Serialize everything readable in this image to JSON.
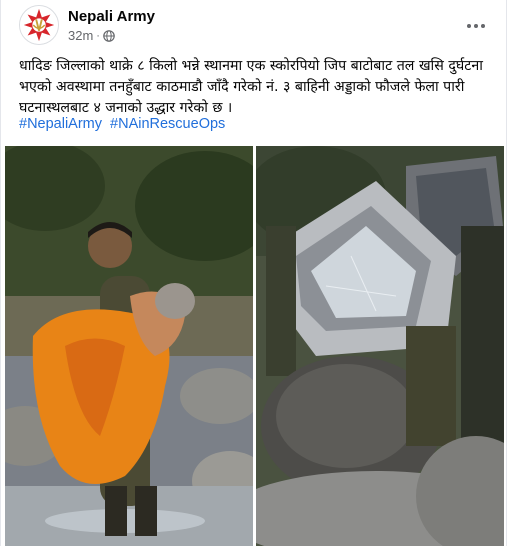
{
  "post": {
    "page_name": "Nepali Army",
    "time": "32m",
    "separator": "·",
    "privacy_icon": "globe-icon",
    "more_icon": "more-options-icon",
    "text": "धादिङ जिल्लाको थाक्रे ८ किलो भन्ने स्थानमा एक स्कोरपियो जिप बाटोबाट तल खसि दुर्घटना भएको अवस्थामा तनहुँबाट काठमाडौ जाँदै गरेको नं. ३ बाहिनी अड्डाको फौजले फेला पारी घटनास्थलबाट ४ जनाको उद्धार गरेको छ ।",
    "hashtags": [
      "#NepaliArmy",
      "#NAinRescueOps"
    ]
  },
  "photos": {
    "left": "soldier-carrying-rescued-woman-photo",
    "right": "crashed-suv-on-rocks-photo"
  },
  "colors": {
    "link": "#216fdb",
    "meta_text": "#65676b",
    "emblem_red": "#d7262b",
    "emblem_gold": "#c8a13a"
  }
}
